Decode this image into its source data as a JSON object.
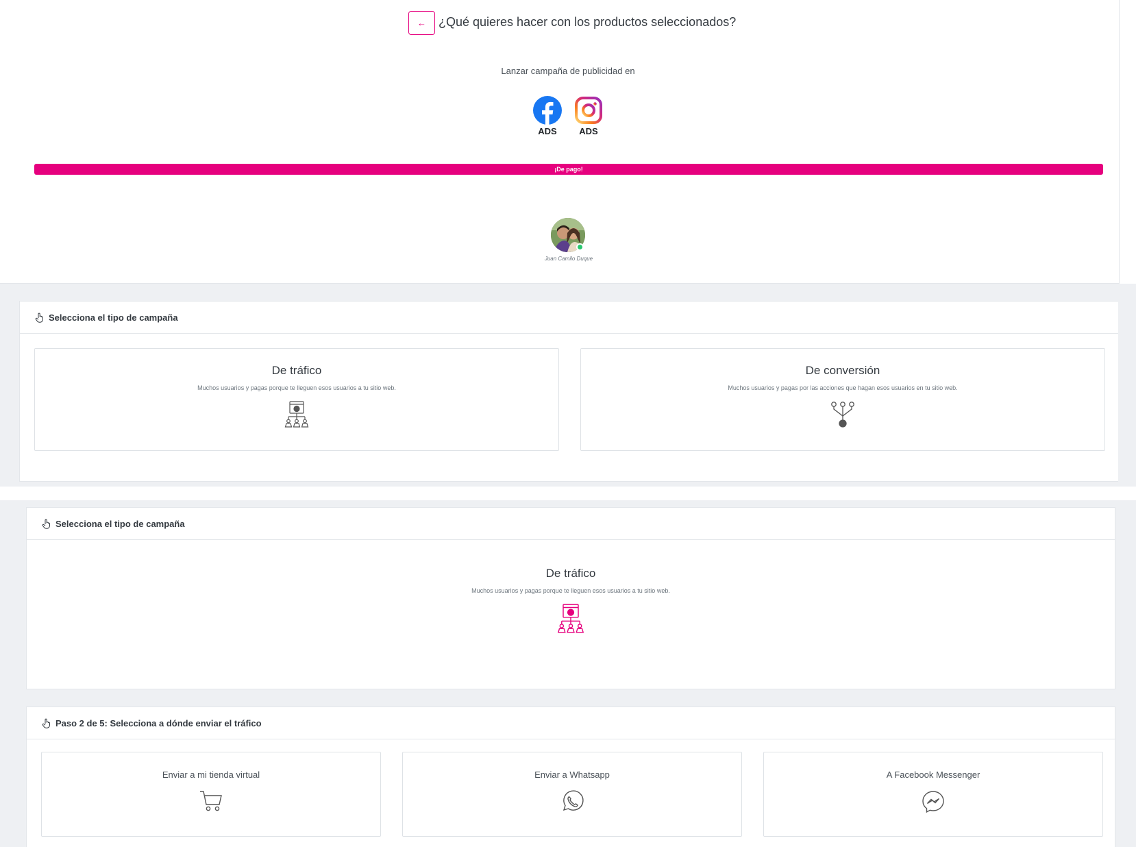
{
  "header": {
    "back_label": "←",
    "question": "¿Qué quieres hacer con los productos seleccionados?"
  },
  "launch": {
    "text": "Lanzar campaña de publicidad en",
    "platforms": [
      {
        "name": "facebook",
        "label": "ADS",
        "icon": "facebook-icon"
      },
      {
        "name": "instagram",
        "label": "ADS",
        "icon": "instagram-icon"
      }
    ]
  },
  "paid_bar": {
    "label": "¡De pago!",
    "color": "#e6007e"
  },
  "user": {
    "name": "Juan Camilo Duque",
    "status": "online"
  },
  "campaign_select": {
    "heading": "Selecciona el tipo de campaña",
    "options": [
      {
        "title": "De tráfico",
        "desc": "Muchos usuarios y pagas porque te lleguen esos usuarios a tu sitio web.",
        "icon": "traffic-network-icon"
      },
      {
        "title": "De conversión",
        "desc": "Muchos usuarios y pagas por las acciones que hagan esos usuarios en tu sitio web.",
        "icon": "conversion-funnel-icon"
      }
    ]
  },
  "campaign_selected": {
    "heading": "Selecciona el tipo de campaña",
    "title": "De tráfico",
    "desc": "Muchos usuarios y pagas porque te lleguen esos usuarios a tu sitio web.",
    "icon": "traffic-network-icon"
  },
  "step2": {
    "heading": "Paso 2 de 5: Selecciona a dónde enviar el tráfico",
    "options": [
      {
        "label": "Enviar a mi tienda virtual",
        "icon": "cart-icon"
      },
      {
        "label": "Enviar a Whatsapp",
        "icon": "whatsapp-icon"
      },
      {
        "label": "A Facebook Messenger",
        "icon": "messenger-icon"
      }
    ]
  },
  "colors": {
    "accent": "#e6007e",
    "online": "#28c76f",
    "background": "#eef0f3"
  }
}
